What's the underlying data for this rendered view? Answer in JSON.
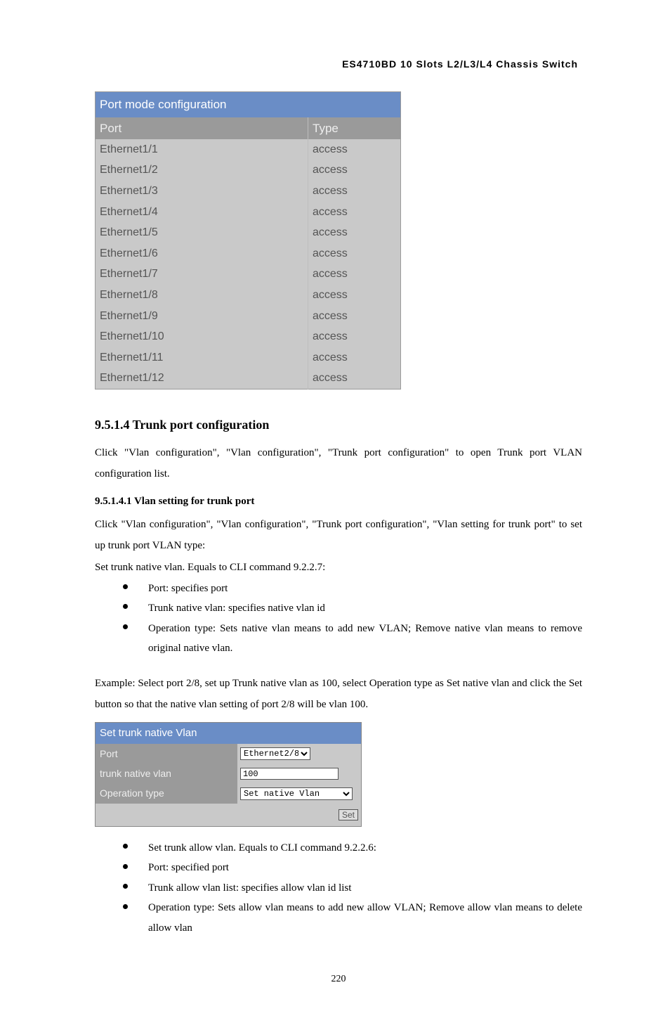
{
  "header": "ES4710BD 10 Slots L2/L3/L4 Chassis Switch",
  "table1": {
    "title": "Port mode configuration",
    "col_port": "Port",
    "col_type": "Type",
    "rows": [
      {
        "port": "Ethernet1/1",
        "type": "access"
      },
      {
        "port": "Ethernet1/2",
        "type": "access"
      },
      {
        "port": "Ethernet1/3",
        "type": "access"
      },
      {
        "port": "Ethernet1/4",
        "type": "access"
      },
      {
        "port": "Ethernet1/5",
        "type": "access"
      },
      {
        "port": "Ethernet1/6",
        "type": "access"
      },
      {
        "port": "Ethernet1/7",
        "type": "access"
      },
      {
        "port": "Ethernet1/8",
        "type": "access"
      },
      {
        "port": "Ethernet1/9",
        "type": "access"
      },
      {
        "port": "Ethernet1/10",
        "type": "access"
      },
      {
        "port": "Ethernet1/11",
        "type": "access"
      },
      {
        "port": "Ethernet1/12",
        "type": "access"
      }
    ]
  },
  "sect_9514": {
    "heading": "9.5.1.4    Trunk port configuration",
    "p1": "Click \"Vlan configuration\", \"Vlan configuration\", \"Trunk port configuration\" to open Trunk port VLAN configuration list."
  },
  "sect_95141": {
    "heading": "9.5.1.4.1   Vlan setting for trunk port",
    "p1": "Click \"Vlan configuration\", \"Vlan configuration\", \"Trunk port configuration\", \"Vlan setting for trunk port\" to set up trunk port VLAN type:",
    "p2": "Set trunk native vlan. Equals to CLI command 9.2.2.7:",
    "bul1": [
      "Port: specifies port",
      "Trunk native vlan: specifies native vlan id",
      "Operation type: Sets native vlan means to add new VLAN; Remove native vlan means to remove original native vlan."
    ],
    "p3": "Example: Select port 2/8, set up Trunk native vlan as 100, select Operation type as Set native vlan and click the Set button so that the native vlan setting of port 2/8 will be vlan 100."
  },
  "table2": {
    "title": "Set trunk native Vlan",
    "row_port": "Port",
    "row_native": "trunk native vlan",
    "row_op": "Operation type",
    "port_value": "Ethernet2/8",
    "native_value": "100",
    "op_value": "Set native Vlan",
    "btn": "Set"
  },
  "bul2": [
    "Set trunk allow vlan. Equals to CLI command 9.2.2.6:",
    "Port: specified port",
    "Trunk allow vlan list: specifies allow vlan id list",
    "Operation type: Sets allow vlan means to add new allow VLAN; Remove allow vlan means to delete allow vlan"
  ],
  "page": "220"
}
